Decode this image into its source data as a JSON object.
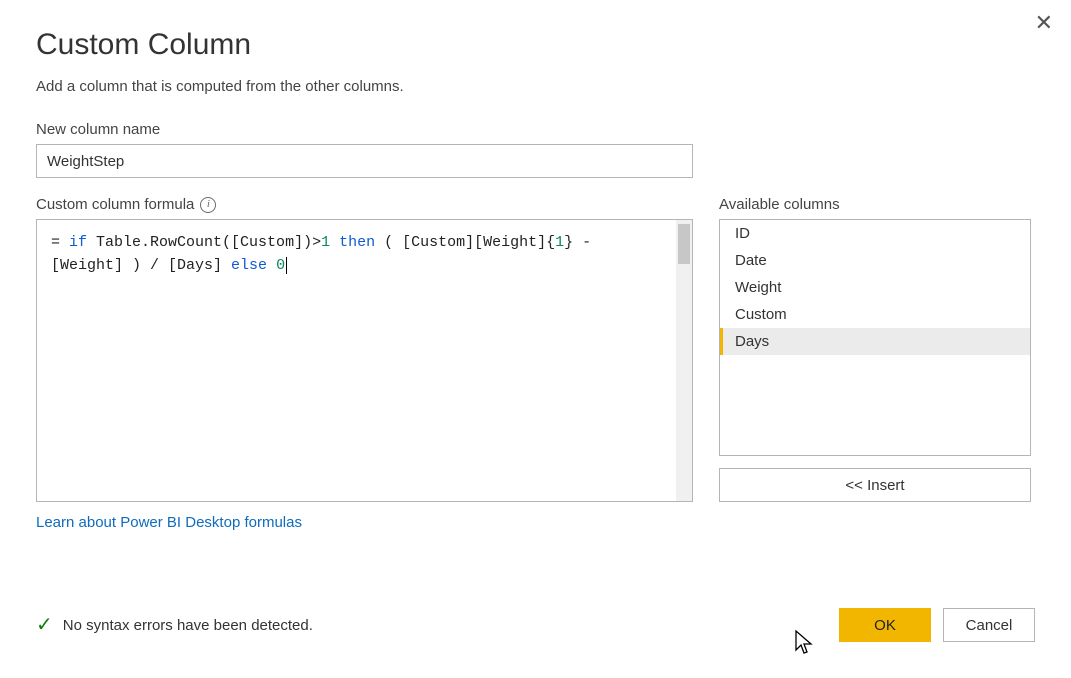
{
  "dialog": {
    "title": "Custom Column",
    "subtitle": "Add a column that is computed from the other columns.",
    "close_label": "✕"
  },
  "column_name": {
    "label": "New column name",
    "value": "WeightStep"
  },
  "formula": {
    "label": "Custom column formula",
    "info_glyph": "i",
    "tokens": {
      "eq": "= ",
      "kw_if": "if",
      "t1": " Table.RowCount([Custom])>",
      "n1": "1",
      "t2": " ",
      "kw_then": "then",
      "t3": " ( [Custom][Weight]{",
      "n2": "1",
      "t4": "} - [Weight] ) / [Days] ",
      "kw_else": "else",
      "t5": " ",
      "n3": "0"
    }
  },
  "available": {
    "label": "Available columns",
    "items": [
      "ID",
      "Date",
      "Weight",
      "Custom",
      "Days"
    ],
    "selected_index": 4
  },
  "insert_button": "<< Insert",
  "learn_link": "Learn about Power BI Desktop formulas",
  "status": {
    "check": "✓",
    "text": "No syntax errors have been detected."
  },
  "buttons": {
    "ok": "OK",
    "cancel": "Cancel"
  }
}
